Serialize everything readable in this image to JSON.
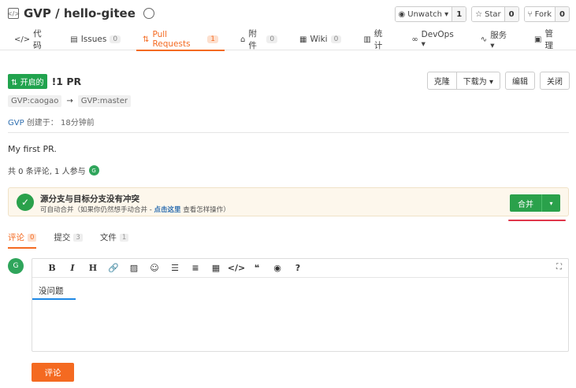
{
  "repo": {
    "title": "GVP / hello-gitee",
    "watch": {
      "label": "Unwatch ▾",
      "count": "1"
    },
    "star": {
      "label": "Star",
      "count": "0"
    },
    "fork": {
      "label": "Fork",
      "count": "0"
    }
  },
  "tabs": [
    {
      "icon": "</>",
      "label": "代码",
      "count": null
    },
    {
      "icon": "▤",
      "label": "Issues",
      "count": "0"
    },
    {
      "icon": "⇅",
      "label": "Pull Requests",
      "count": "1"
    },
    {
      "icon": "⌂",
      "label": "附件",
      "count": "0"
    },
    {
      "icon": "▦",
      "label": "Wiki",
      "count": "0"
    },
    {
      "icon": "▥",
      "label": "统计",
      "count": null
    },
    {
      "icon": "∞",
      "label": "DevOps ▾",
      "count": null
    },
    {
      "icon": "∿",
      "label": "服务 ▾",
      "count": null
    },
    {
      "icon": "▣",
      "label": "管理",
      "count": null
    }
  ],
  "pr": {
    "status": "开启的",
    "number": "!1 PR",
    "source_branch": "GVP:caogao",
    "arrow": "→",
    "target_branch": "GVP:master",
    "author": "GVP",
    "created_label": "创建于：",
    "created_time": "18分钟前",
    "description": "My first PR.",
    "stats": "共 0 条评论, 1 人参与",
    "participant_initial": "G"
  },
  "pr_actions": {
    "clone": "克隆",
    "download": "下载为 ▾",
    "edit": "编辑",
    "close": "关闭"
  },
  "merge": {
    "title": "源分支与目标分支没有冲突",
    "subtitle_pre": "可自动合并（如果你仍然想手动合并 - ",
    "subtitle_link": "点击这里",
    "subtitle_post": " 查看怎样操作）",
    "button": "合并",
    "dropdown": "▾"
  },
  "subtabs": [
    {
      "label": "评论",
      "count": "0"
    },
    {
      "label": "提交",
      "count": "3"
    },
    {
      "label": "文件",
      "count": "1"
    }
  ],
  "editor": {
    "avatar_initial": "G",
    "content": "没问题",
    "toolbar": [
      "B",
      "I",
      "H",
      "🔗",
      "▨",
      "☺",
      "☰",
      "≡",
      "▦",
      "</>",
      "❝",
      "◉",
      "?"
    ],
    "fullscreen": "⛶"
  },
  "submit_label": "评论"
}
